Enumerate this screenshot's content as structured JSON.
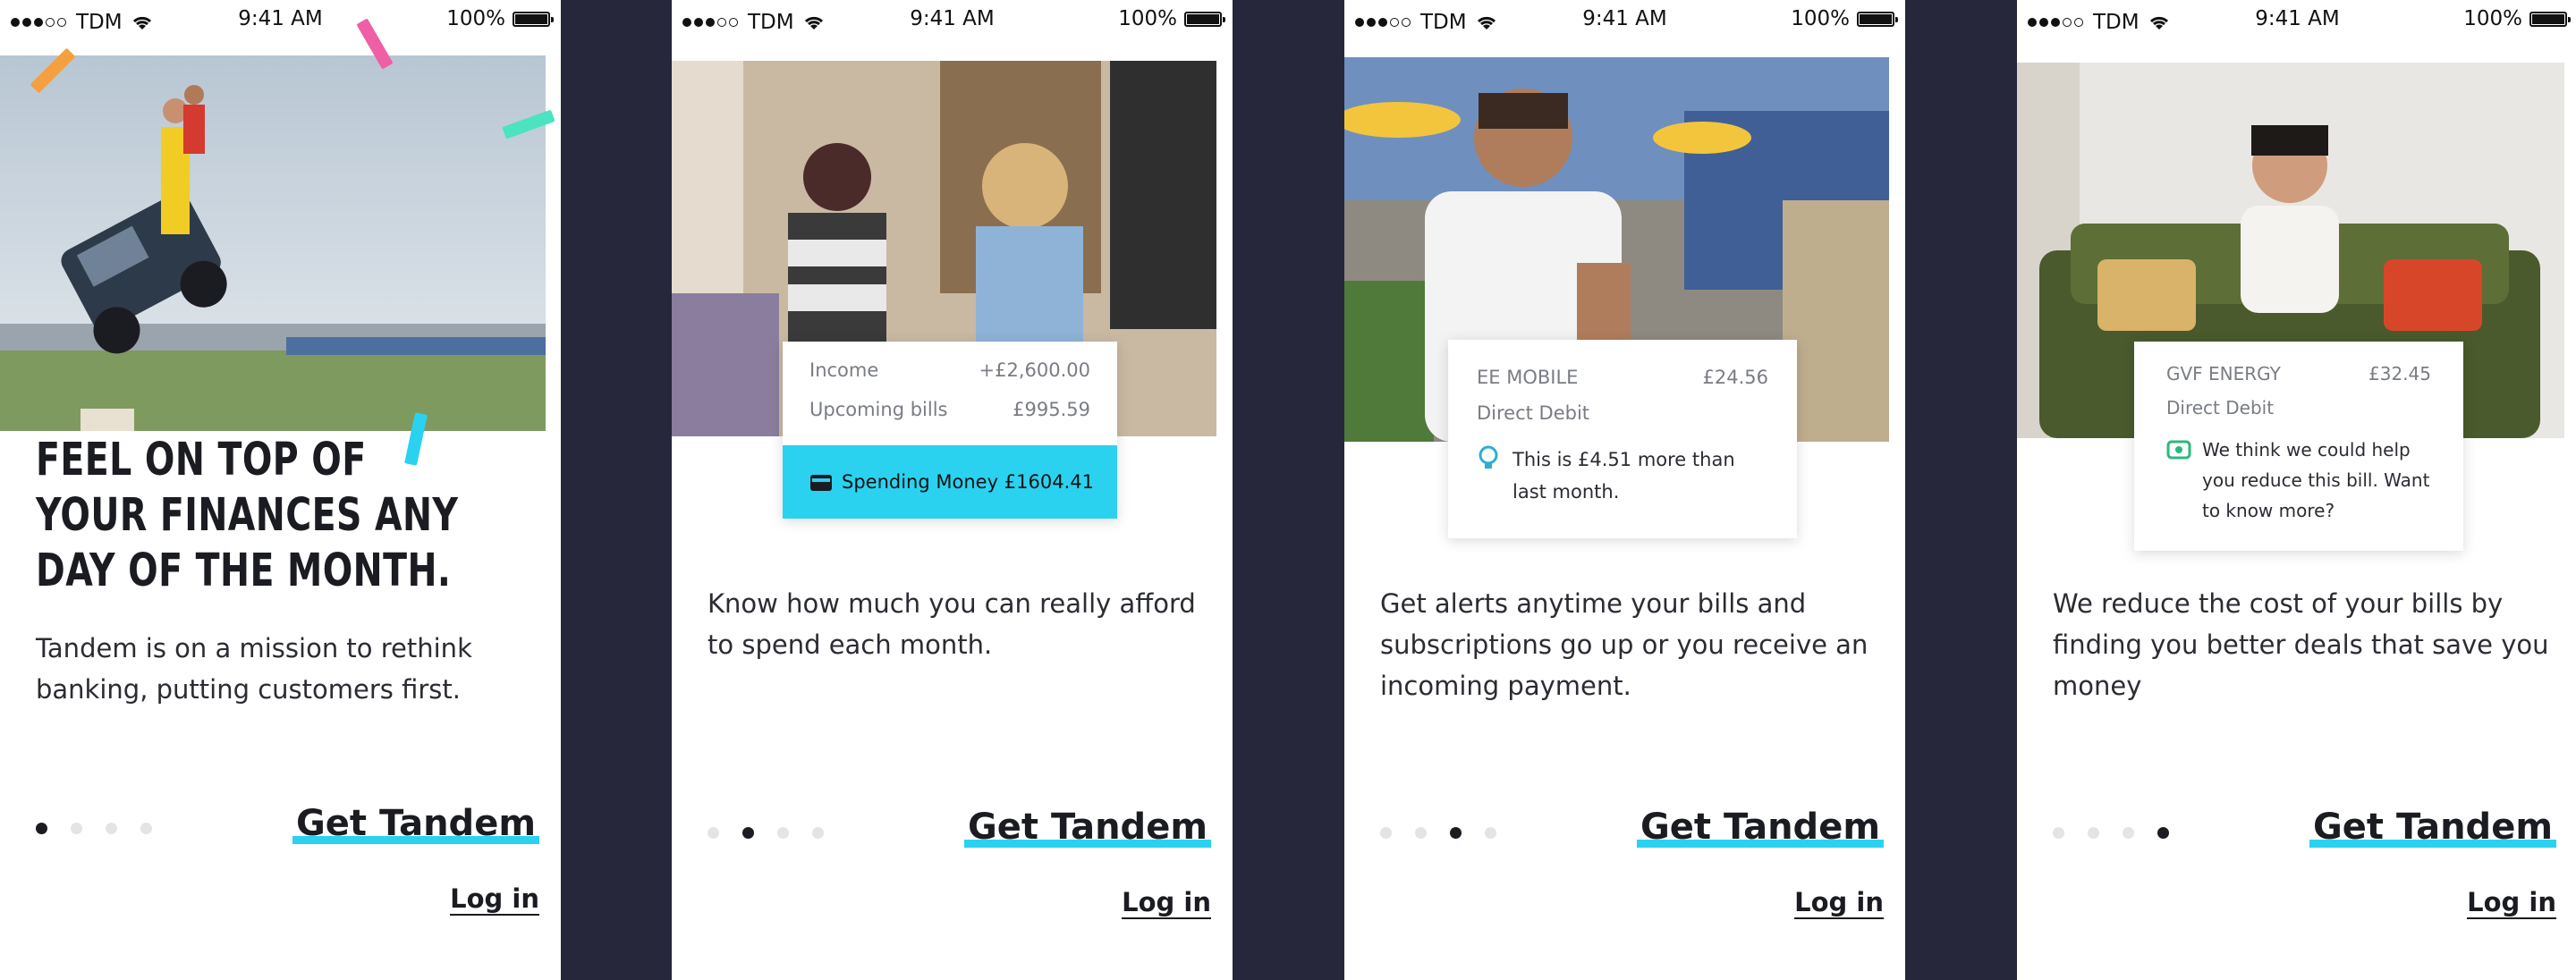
{
  "status_bar": {
    "carrier": "TDM",
    "time": "9:41 AM",
    "battery": "100%"
  },
  "colors": {
    "accent": "#2ad2f0",
    "bg": "#26273b",
    "text": "#1b1c21",
    "green": "#2db87c"
  },
  "screens": [
    {
      "headline": "FEEL ON TOP OF YOUR FINANCES ANY DAY OF THE MONTH.",
      "body": "Tandem is on a mission to rethink banking, putting customers first.",
      "cta": "Get Tandem",
      "login": "Log in",
      "active_dot": 0
    },
    {
      "card": {
        "income_label": "Income",
        "income_value": "+£2,600.00",
        "bills_label": "Upcoming bills",
        "bills_value": "£995.59",
        "spend_label": "Spending Money",
        "spend_value": "£1604.41"
      },
      "body": "Know how much you can really afford to spend each month.",
      "cta": "Get Tandem",
      "login": "Log in",
      "active_dot": 1
    },
    {
      "card": {
        "merchant": "EE MOBILE",
        "amount": "£24.56",
        "type": "Direct Debit",
        "alert": "This is £4.51 more than last month."
      },
      "body": "Get alerts anytime your bills and subscriptions go up or you receive an incoming payment.",
      "cta": "Get Tandem",
      "login": "Log in",
      "active_dot": 2
    },
    {
      "card": {
        "merchant": "GVF ENERGY",
        "amount": "£32.45",
        "type": "Direct Debit",
        "alert": "We think we could help you reduce this bill. Want to know more?"
      },
      "body": "We reduce the cost of your bills by finding you better deals that save you money",
      "cta": "Get Tandem",
      "login": "Log in",
      "active_dot": 3
    }
  ]
}
